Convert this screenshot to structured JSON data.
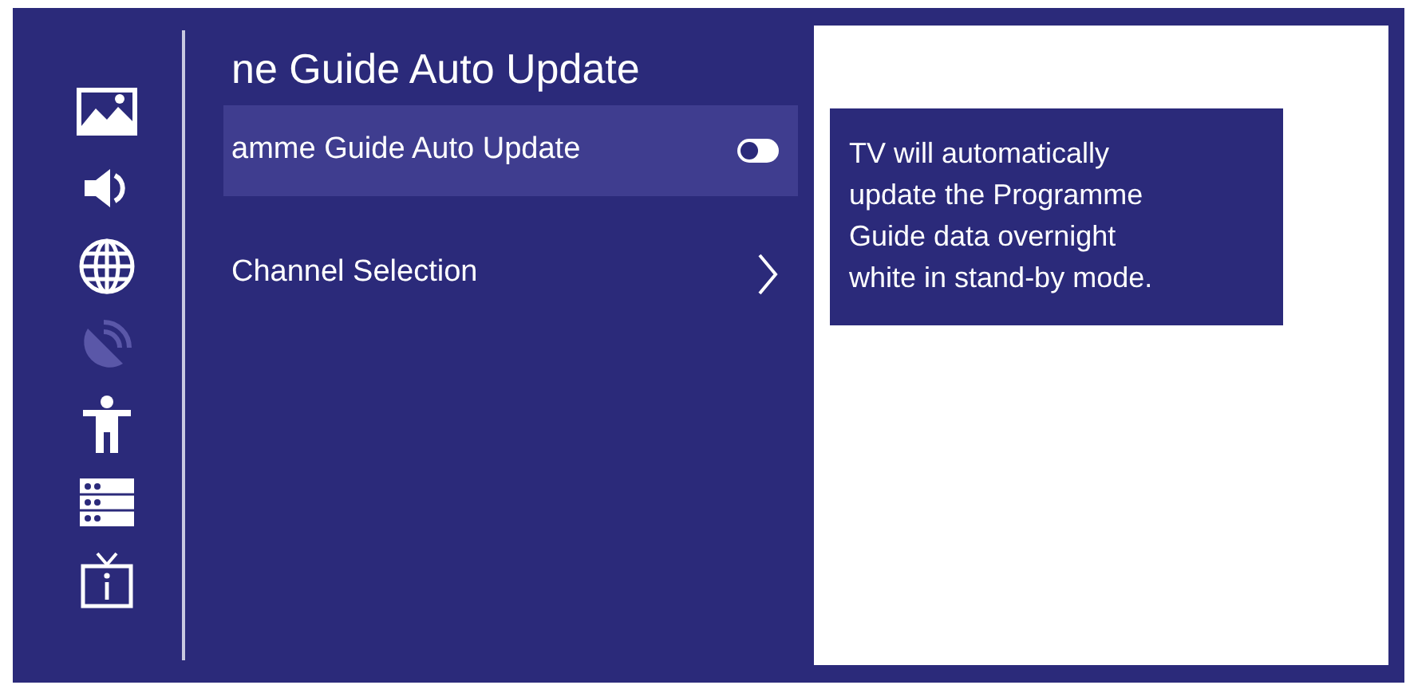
{
  "sidebar": {
    "items": [
      {
        "kind": "picture",
        "disabled": false
      },
      {
        "kind": "sound",
        "disabled": false
      },
      {
        "kind": "network",
        "disabled": false
      },
      {
        "kind": "satellite",
        "disabled": true
      },
      {
        "kind": "accessibility",
        "disabled": false
      },
      {
        "kind": "list",
        "disabled": false
      },
      {
        "kind": "tv-info",
        "disabled": false
      }
    ]
  },
  "menu": {
    "title": "ne Guide Auto Update",
    "items": [
      {
        "kind": "toggle",
        "label": "amme Guide Auto Update",
        "selected": true,
        "on": false
      },
      {
        "kind": "submenu",
        "label": "Channel Selection",
        "selected": false
      }
    ]
  },
  "help": {
    "text": "TV will automatically update the Programme Guide data overnight white in stand-by mode."
  }
}
